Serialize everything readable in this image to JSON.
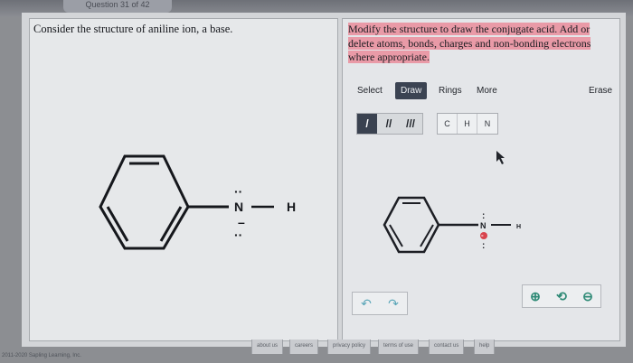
{
  "window": {
    "tab_title": "Question 31 of 42"
  },
  "left_panel": {
    "question": "Consider the structure of aniline ion, a base.",
    "molecule": {
      "nitrogen": "N",
      "hydrogen": "H",
      "lone_pair_top": "··",
      "lone_pair_bottom": "··",
      "dash": "–"
    }
  },
  "right_panel": {
    "instructions": "Modify the structure to draw the conjugate acid. Add or delete atoms, bonds, charges and non-bonding electrons where appropriate.",
    "toolbar": {
      "select": "Select",
      "draw": "Draw",
      "rings": "Rings",
      "more": "More",
      "erase": "Erase"
    },
    "bond_buttons": [
      "/",
      "//",
      "///"
    ],
    "atom_buttons": [
      "C",
      "H",
      "N"
    ],
    "molecule": {
      "nitrogen": "N",
      "hydrogen": "H",
      "lone_pair_top": ":",
      "lone_pair_bottom": ":",
      "charge": "-"
    },
    "undo_icons": [
      "↶",
      "↷"
    ],
    "zoom_icons": [
      "⊕",
      "⟲",
      "⊖"
    ]
  },
  "footer": {
    "links": [
      "about us",
      "careers",
      "privacy policy",
      "terms of use",
      "contact us",
      "help"
    ],
    "copyright": "2011-2020 Sapling Learning, Inc."
  },
  "colors": {
    "highlight": "#e99aa7",
    "draw_active": "#3b4352",
    "undo": "#5ba6b8",
    "zoom": "#2f8a76",
    "charge": "#d8434d"
  }
}
